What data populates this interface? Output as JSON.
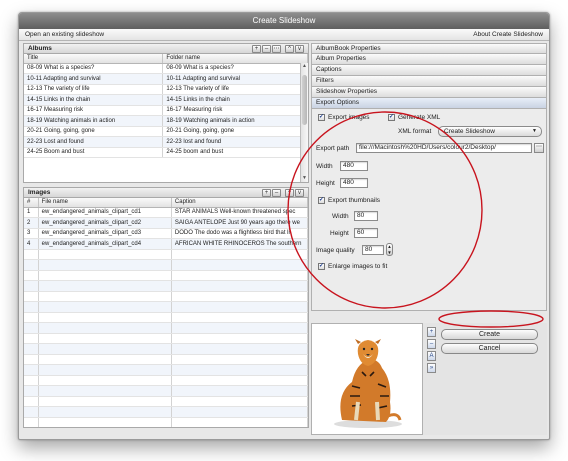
{
  "window": {
    "title": "Create Slideshow"
  },
  "menu": {
    "open_existing": "Open an existing slideshow",
    "about": "About Create Slideshow"
  },
  "albums": {
    "title": "Albums",
    "columns": [
      "Title",
      "Folder name"
    ],
    "rows": [
      [
        "08-09 What is a species?",
        "08-09 What is a species?"
      ],
      [
        "10-11 Adapting and survival",
        "10-11 Adapting and survival"
      ],
      [
        "12-13 The variety of life",
        "12-13 The variety of life"
      ],
      [
        "14-15 Links in the chain",
        "14-15 Links in the chain"
      ],
      [
        "16-17 Measuring risk",
        "16-17 Measuring risk"
      ],
      [
        "18-19 Watching animals in action",
        "18-19 Watching animals in action"
      ],
      [
        "20-21 Going, going, gone",
        "20-21 Going, going, gone"
      ],
      [
        "22-23 Lost and found",
        "22-23 lost and found"
      ],
      [
        "24-25 Boom and bust",
        "24-25 boom and bust"
      ]
    ]
  },
  "images": {
    "title": "Images",
    "columns": [
      "#",
      "File name",
      "Caption"
    ],
    "rows": [
      [
        "1",
        "ew_endangered_animals_clipart_cd1",
        "STAR ANIMALS Well-known threatened spec"
      ],
      [
        "2",
        "ew_endangered_animals_clipart_cd2",
        "SAIGA ANTELOPE Just 90 years ago there we"
      ],
      [
        "3",
        "ew_endangered_animals_clipart_cd3",
        "DODO The dodo was a flightless bird that li"
      ],
      [
        "4",
        "ew_endangered_animals_clipart_cd4",
        "AFRICAN WHITE RHINOCEROS The southern"
      ]
    ]
  },
  "accordion": [
    "AlbumBook Properties",
    "Album Properties",
    "Captions",
    "Filters",
    "Slideshow Properties",
    "Export Options"
  ],
  "export": {
    "export_images": "Export images",
    "generate_xml": "Generate XML",
    "xml_format_label": "XML format",
    "xml_format_value": "Create Slideshow",
    "export_path_label": "Export path",
    "export_path_value": "file:///Macintosh%20HD/Users/colour2/Desktop/",
    "width_label": "Width",
    "width_value": "480",
    "height_label": "Height",
    "height_value": "480",
    "export_thumbnails": "Export thumbnails",
    "thumb_width_label": "Width",
    "thumb_width_value": "80",
    "thumb_height_label": "Height",
    "thumb_height_value": "60",
    "quality_label": "Image quality",
    "quality_value": "80",
    "enlarge": "Enlarge images to fit"
  },
  "buttons": {
    "create": "Create",
    "cancel": "Cancel"
  },
  "colors": {
    "annotation": "#c8141e",
    "accent": "#1a3a8a"
  }
}
